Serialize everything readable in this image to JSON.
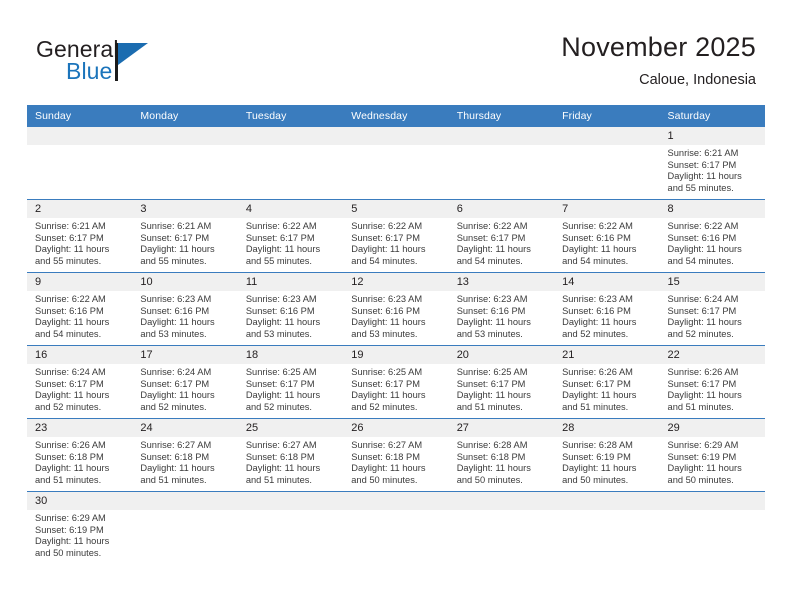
{
  "brand": {
    "word1": "General",
    "word2": "Blue",
    "accent_color": "#1b6cb0"
  },
  "header": {
    "title": "November 2025",
    "subtitle": "Caloue, Indonesia"
  },
  "calendar": {
    "header_bg": "#3a7cbe",
    "daynum_bg": "#f0f0f0",
    "weekdays": [
      "Sunday",
      "Monday",
      "Tuesday",
      "Wednesday",
      "Thursday",
      "Friday",
      "Saturday"
    ],
    "labels": {
      "sunrise": "Sunrise:",
      "sunset": "Sunset:",
      "daylight": "Daylight:"
    },
    "weeks": [
      [
        {
          "blank": true
        },
        {
          "blank": true
        },
        {
          "blank": true
        },
        {
          "blank": true
        },
        {
          "blank": true
        },
        {
          "blank": true
        },
        {
          "day": "1",
          "sunrise": "Sunrise: 6:21 AM",
          "sunset": "Sunset: 6:17 PM",
          "daylight_1": "Daylight: 11 hours",
          "daylight_2": "and 55 minutes."
        }
      ],
      [
        {
          "day": "2",
          "sunrise": "Sunrise: 6:21 AM",
          "sunset": "Sunset: 6:17 PM",
          "daylight_1": "Daylight: 11 hours",
          "daylight_2": "and 55 minutes."
        },
        {
          "day": "3",
          "sunrise": "Sunrise: 6:21 AM",
          "sunset": "Sunset: 6:17 PM",
          "daylight_1": "Daylight: 11 hours",
          "daylight_2": "and 55 minutes."
        },
        {
          "day": "4",
          "sunrise": "Sunrise: 6:22 AM",
          "sunset": "Sunset: 6:17 PM",
          "daylight_1": "Daylight: 11 hours",
          "daylight_2": "and 55 minutes."
        },
        {
          "day": "5",
          "sunrise": "Sunrise: 6:22 AM",
          "sunset": "Sunset: 6:17 PM",
          "daylight_1": "Daylight: 11 hours",
          "daylight_2": "and 54 minutes."
        },
        {
          "day": "6",
          "sunrise": "Sunrise: 6:22 AM",
          "sunset": "Sunset: 6:17 PM",
          "daylight_1": "Daylight: 11 hours",
          "daylight_2": "and 54 minutes."
        },
        {
          "day": "7",
          "sunrise": "Sunrise: 6:22 AM",
          "sunset": "Sunset: 6:16 PM",
          "daylight_1": "Daylight: 11 hours",
          "daylight_2": "and 54 minutes."
        },
        {
          "day": "8",
          "sunrise": "Sunrise: 6:22 AM",
          "sunset": "Sunset: 6:16 PM",
          "daylight_1": "Daylight: 11 hours",
          "daylight_2": "and 54 minutes."
        }
      ],
      [
        {
          "day": "9",
          "sunrise": "Sunrise: 6:22 AM",
          "sunset": "Sunset: 6:16 PM",
          "daylight_1": "Daylight: 11 hours",
          "daylight_2": "and 54 minutes."
        },
        {
          "day": "10",
          "sunrise": "Sunrise: 6:23 AM",
          "sunset": "Sunset: 6:16 PM",
          "daylight_1": "Daylight: 11 hours",
          "daylight_2": "and 53 minutes."
        },
        {
          "day": "11",
          "sunrise": "Sunrise: 6:23 AM",
          "sunset": "Sunset: 6:16 PM",
          "daylight_1": "Daylight: 11 hours",
          "daylight_2": "and 53 minutes."
        },
        {
          "day": "12",
          "sunrise": "Sunrise: 6:23 AM",
          "sunset": "Sunset: 6:16 PM",
          "daylight_1": "Daylight: 11 hours",
          "daylight_2": "and 53 minutes."
        },
        {
          "day": "13",
          "sunrise": "Sunrise: 6:23 AM",
          "sunset": "Sunset: 6:16 PM",
          "daylight_1": "Daylight: 11 hours",
          "daylight_2": "and 53 minutes."
        },
        {
          "day": "14",
          "sunrise": "Sunrise: 6:23 AM",
          "sunset": "Sunset: 6:16 PM",
          "daylight_1": "Daylight: 11 hours",
          "daylight_2": "and 52 minutes."
        },
        {
          "day": "15",
          "sunrise": "Sunrise: 6:24 AM",
          "sunset": "Sunset: 6:17 PM",
          "daylight_1": "Daylight: 11 hours",
          "daylight_2": "and 52 minutes."
        }
      ],
      [
        {
          "day": "16",
          "sunrise": "Sunrise: 6:24 AM",
          "sunset": "Sunset: 6:17 PM",
          "daylight_1": "Daylight: 11 hours",
          "daylight_2": "and 52 minutes."
        },
        {
          "day": "17",
          "sunrise": "Sunrise: 6:24 AM",
          "sunset": "Sunset: 6:17 PM",
          "daylight_1": "Daylight: 11 hours",
          "daylight_2": "and 52 minutes."
        },
        {
          "day": "18",
          "sunrise": "Sunrise: 6:25 AM",
          "sunset": "Sunset: 6:17 PM",
          "daylight_1": "Daylight: 11 hours",
          "daylight_2": "and 52 minutes."
        },
        {
          "day": "19",
          "sunrise": "Sunrise: 6:25 AM",
          "sunset": "Sunset: 6:17 PM",
          "daylight_1": "Daylight: 11 hours",
          "daylight_2": "and 52 minutes."
        },
        {
          "day": "20",
          "sunrise": "Sunrise: 6:25 AM",
          "sunset": "Sunset: 6:17 PM",
          "daylight_1": "Daylight: 11 hours",
          "daylight_2": "and 51 minutes."
        },
        {
          "day": "21",
          "sunrise": "Sunrise: 6:26 AM",
          "sunset": "Sunset: 6:17 PM",
          "daylight_1": "Daylight: 11 hours",
          "daylight_2": "and 51 minutes."
        },
        {
          "day": "22",
          "sunrise": "Sunrise: 6:26 AM",
          "sunset": "Sunset: 6:17 PM",
          "daylight_1": "Daylight: 11 hours",
          "daylight_2": "and 51 minutes."
        }
      ],
      [
        {
          "day": "23",
          "sunrise": "Sunrise: 6:26 AM",
          "sunset": "Sunset: 6:18 PM",
          "daylight_1": "Daylight: 11 hours",
          "daylight_2": "and 51 minutes."
        },
        {
          "day": "24",
          "sunrise": "Sunrise: 6:27 AM",
          "sunset": "Sunset: 6:18 PM",
          "daylight_1": "Daylight: 11 hours",
          "daylight_2": "and 51 minutes."
        },
        {
          "day": "25",
          "sunrise": "Sunrise: 6:27 AM",
          "sunset": "Sunset: 6:18 PM",
          "daylight_1": "Daylight: 11 hours",
          "daylight_2": "and 51 minutes."
        },
        {
          "day": "26",
          "sunrise": "Sunrise: 6:27 AM",
          "sunset": "Sunset: 6:18 PM",
          "daylight_1": "Daylight: 11 hours",
          "daylight_2": "and 50 minutes."
        },
        {
          "day": "27",
          "sunrise": "Sunrise: 6:28 AM",
          "sunset": "Sunset: 6:18 PM",
          "daylight_1": "Daylight: 11 hours",
          "daylight_2": "and 50 minutes."
        },
        {
          "day": "28",
          "sunrise": "Sunrise: 6:28 AM",
          "sunset": "Sunset: 6:19 PM",
          "daylight_1": "Daylight: 11 hours",
          "daylight_2": "and 50 minutes."
        },
        {
          "day": "29",
          "sunrise": "Sunrise: 6:29 AM",
          "sunset": "Sunset: 6:19 PM",
          "daylight_1": "Daylight: 11 hours",
          "daylight_2": "and 50 minutes."
        }
      ],
      [
        {
          "day": "30",
          "sunrise": "Sunrise: 6:29 AM",
          "sunset": "Sunset: 6:19 PM",
          "daylight_1": "Daylight: 11 hours",
          "daylight_2": "and 50 minutes."
        },
        {
          "blank": true
        },
        {
          "blank": true
        },
        {
          "blank": true
        },
        {
          "blank": true
        },
        {
          "blank": true
        },
        {
          "blank": true
        }
      ]
    ]
  }
}
